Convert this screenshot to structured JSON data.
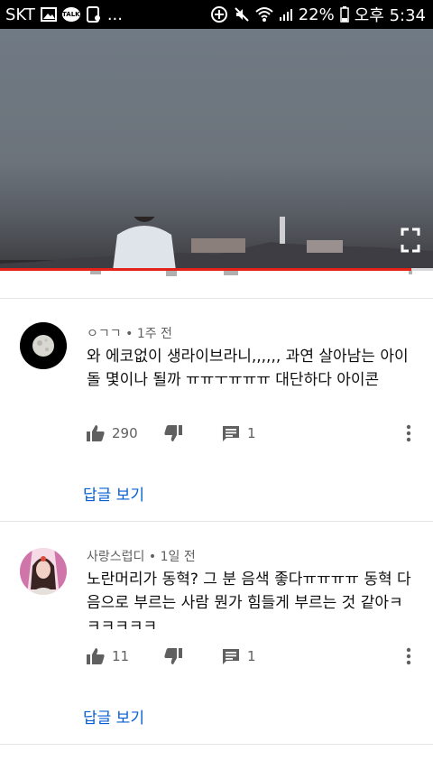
{
  "status_bar": {
    "carrier": "SKT",
    "talk_badge": "TALK",
    "ellipsis": "...",
    "battery": "22%",
    "time": "오후 5:34"
  },
  "video": {
    "progress": 0.95
  },
  "comments": [
    {
      "author": "ㅇㄱㄱ",
      "time": "1주 전",
      "text": "와 에코없이 생라이브라니,,,,,, 과연 살아남는 아이돌 몇이나 될까 ㅠㅠㅜㅠㅠㅠ 대단하다 아이콘",
      "likes": "290",
      "replies_count": "1",
      "view_replies": "답글 보기"
    },
    {
      "author": "사랑스럽디",
      "time": "1일 전",
      "text": "노란머리가 동혁? 그 분 음색 좋다ㅠㅠㅠㅠ 동혁 다음으로 부르는 사람 뭔가 힘들게 부르는 것 같아ㅋㅋㅋㅋㅋㅋ",
      "likes": "11",
      "replies_count": "1",
      "view_replies": "답글 보기"
    }
  ],
  "meta_separator": "•",
  "colors": {
    "link": "#065fd4",
    "progress": "#e62117",
    "secondary_text": "#606060"
  }
}
